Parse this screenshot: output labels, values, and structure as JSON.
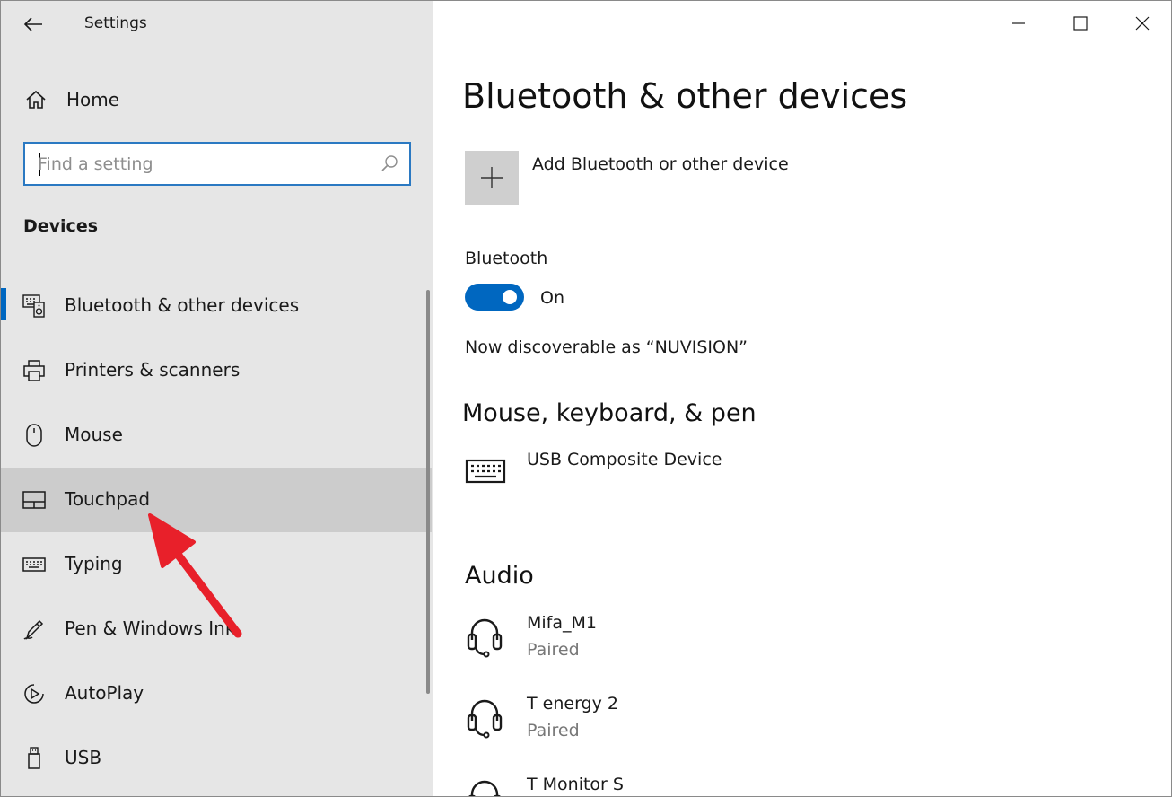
{
  "window": {
    "title": "Settings",
    "controls": [
      "minimize-icon",
      "maximize-icon",
      "close-icon"
    ]
  },
  "sidebar": {
    "home_label": "Home",
    "search": {
      "placeholder": "Find a setting",
      "value": ""
    },
    "section_title": "Devices",
    "items": [
      {
        "label": "Bluetooth & other devices",
        "icon": "bluetooth-devices-icon",
        "selected": true
      },
      {
        "label": "Printers & scanners",
        "icon": "printer-icon"
      },
      {
        "label": "Mouse",
        "icon": "mouse-icon"
      },
      {
        "label": "Touchpad",
        "icon": "touchpad-icon",
        "hovered": true
      },
      {
        "label": "Typing",
        "icon": "keyboard-icon"
      },
      {
        "label": "Pen & Windows Ink",
        "icon": "pen-icon"
      },
      {
        "label": "AutoPlay",
        "icon": "autoplay-icon"
      },
      {
        "label": "USB",
        "icon": "usb-icon"
      }
    ]
  },
  "main": {
    "title": "Bluetooth & other devices",
    "add_device_label": "Add Bluetooth or other device",
    "bluetooth": {
      "label": "Bluetooth",
      "state": "On",
      "discoverable": "Now discoverable as “NUVISION”"
    },
    "mouse_section": {
      "title": "Mouse, keyboard, & pen",
      "devices": [
        {
          "name": "USB Composite Device",
          "icon": "keyboard-icon"
        }
      ]
    },
    "audio_section": {
      "title": "Audio",
      "devices": [
        {
          "name": "Mifa_M1",
          "status": "Paired",
          "icon": "headset-icon"
        },
        {
          "name": "T energy 2",
          "status": "Paired",
          "icon": "headset-icon"
        },
        {
          "name": "T Monitor S",
          "status": "",
          "icon": "headset-icon"
        }
      ]
    }
  },
  "colors": {
    "accent": "#0067c0",
    "sidebar_bg": "#e6e6e6",
    "hover_bg": "#cccccc",
    "annotation_arrow": "#e8202a"
  }
}
